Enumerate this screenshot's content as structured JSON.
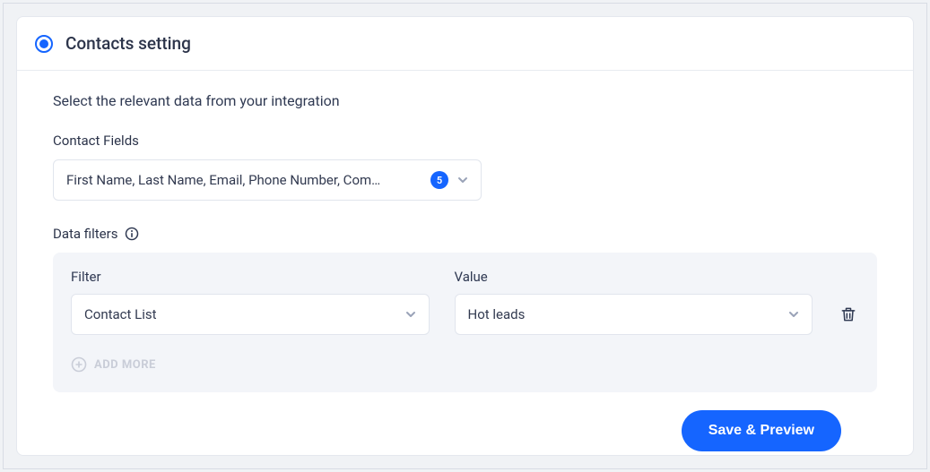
{
  "header": {
    "title": "Contacts setting"
  },
  "intro": "Select the relevant data from your integration",
  "contactFields": {
    "label": "Contact Fields",
    "summary": "First Name, Last Name, Email, Phone Number, Com…",
    "count": "5"
  },
  "dataFilters": {
    "label": "Data filters",
    "filterLabel": "Filter",
    "valueLabel": "Value",
    "rows": [
      {
        "filter": "Contact List",
        "value": "Hot leads"
      }
    ],
    "addMore": "ADD MORE"
  },
  "actions": {
    "save": "Save & Preview"
  }
}
